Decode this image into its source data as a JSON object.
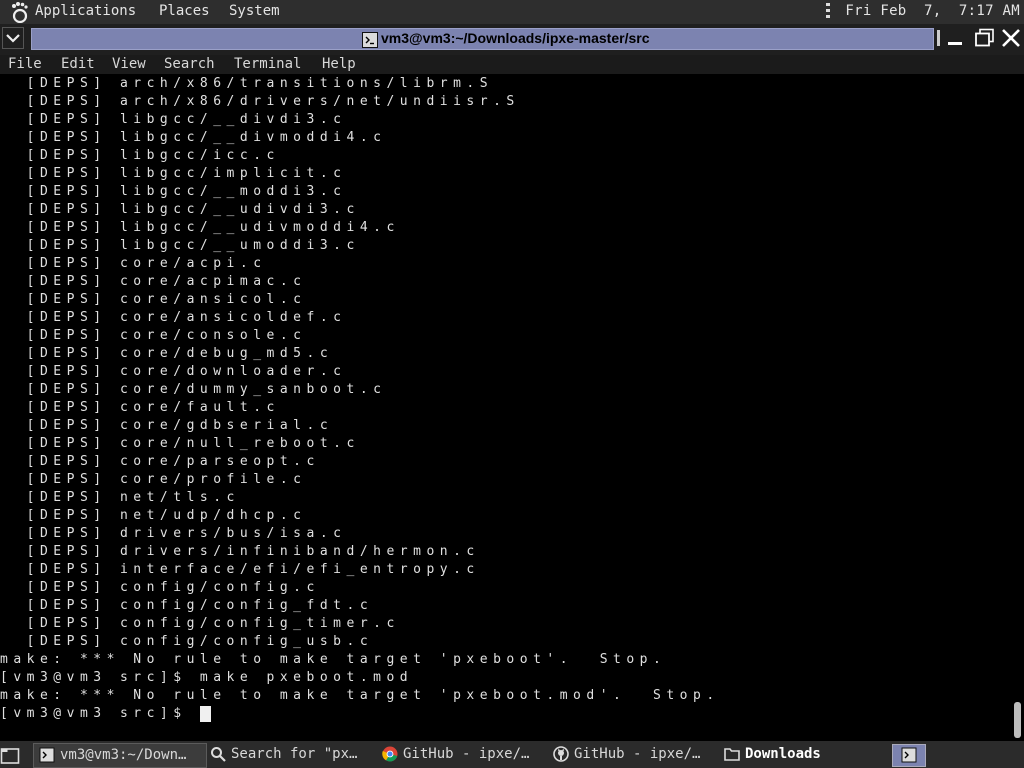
{
  "top_panel": {
    "menus": [
      "Applications",
      "Places",
      "System"
    ],
    "clock": "Fri Feb  7,  7:17 AM"
  },
  "window": {
    "title": "vm3@vm3:~/Downloads/ipxe-master/src"
  },
  "menubar": [
    "File",
    "Edit",
    "View",
    "Search",
    "Terminal",
    "Help"
  ],
  "terminal": {
    "lines": [
      "  [DEPS] arch/x86/transitions/librm.S",
      "  [DEPS] arch/x86/drivers/net/undiisr.S",
      "  [DEPS] libgcc/__divdi3.c",
      "  [DEPS] libgcc/__divmoddi4.c",
      "  [DEPS] libgcc/icc.c",
      "  [DEPS] libgcc/implicit.c",
      "  [DEPS] libgcc/__moddi3.c",
      "  [DEPS] libgcc/__udivdi3.c",
      "  [DEPS] libgcc/__udivmoddi4.c",
      "  [DEPS] libgcc/__umoddi3.c",
      "  [DEPS] core/acpi.c",
      "  [DEPS] core/acpimac.c",
      "  [DEPS] core/ansicol.c",
      "  [DEPS] core/ansicoldef.c",
      "  [DEPS] core/console.c",
      "  [DEPS] core/debug_md5.c",
      "  [DEPS] core/downloader.c",
      "  [DEPS] core/dummy_sanboot.c",
      "  [DEPS] core/fault.c",
      "  [DEPS] core/gdbserial.c",
      "  [DEPS] core/null_reboot.c",
      "  [DEPS] core/parseopt.c",
      "  [DEPS] core/profile.c",
      "  [DEPS] net/tls.c",
      "  [DEPS] net/udp/dhcp.c",
      "  [DEPS] drivers/bus/isa.c",
      "  [DEPS] drivers/infiniband/hermon.c",
      "  [DEPS] interface/efi/efi_entropy.c",
      "  [DEPS] config/config.c",
      "  [DEPS] config/config_fdt.c",
      "  [DEPS] config/config_timer.c",
      "  [DEPS] config/config_usb.c",
      "make: *** No rule to make target 'pxeboot'.  Stop.",
      "[vm3@vm3 src]$ make pxeboot.mod",
      "make: *** No rule to make target 'pxeboot.mod'.  Stop."
    ],
    "prompt": "[vm3@vm3 src]$ "
  },
  "taskbar": {
    "tasks": [
      {
        "label": "vm3@vm3:~/Down…",
        "icon": "terminal-icon"
      },
      {
        "label": "Search for \"px…",
        "icon": "search-icon"
      },
      {
        "label": "GitHub - ipxe/…",
        "icon": "chrome-icon"
      },
      {
        "label": "GitHub - ipxe/…",
        "icon": "github-icon"
      },
      {
        "label": "Downloads",
        "icon": "folder-icon"
      }
    ]
  }
}
